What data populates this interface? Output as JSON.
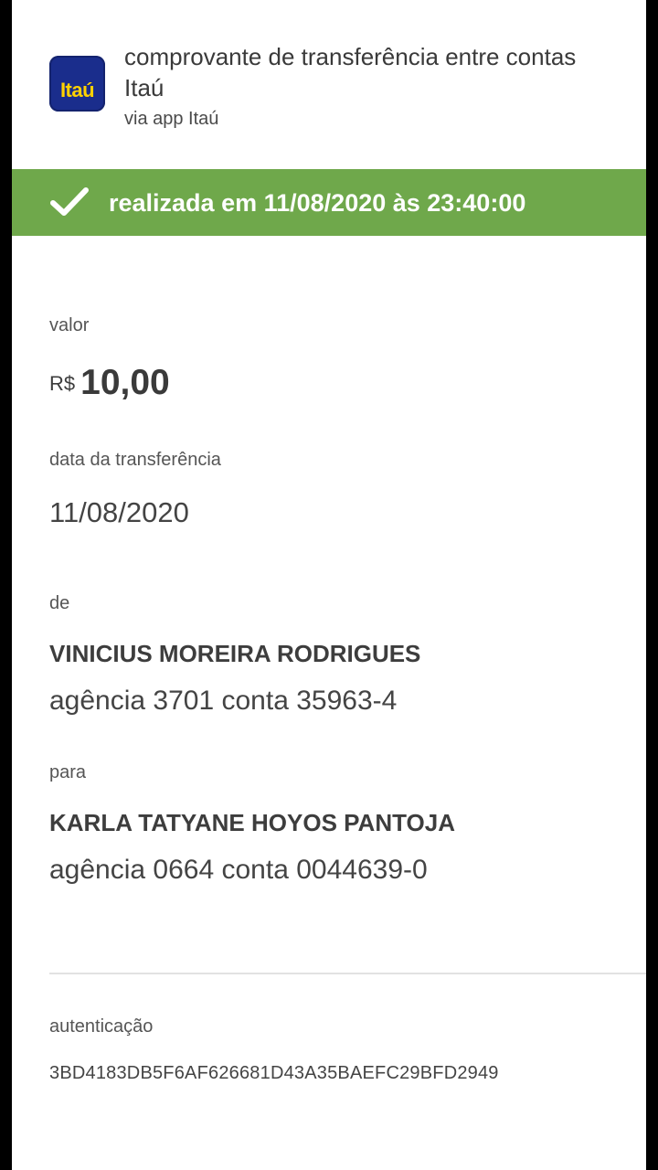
{
  "header": {
    "logo_text": "Itaú",
    "title": "comprovante de transferência entre contas Itaú",
    "subtitle": "via app Itaú"
  },
  "status": {
    "icon": "check-icon",
    "text": "realizada em 11/08/2020 às 23:40:00",
    "color": "#6fa84b"
  },
  "transfer": {
    "value_label": "valor",
    "currency": "R$",
    "amount": "10,00",
    "date_label": "data da transferência",
    "date": "11/08/2020"
  },
  "from": {
    "label": "de",
    "name": "VINICIUS MOREIRA RODRIGUES",
    "account": "agência 3701 conta 35963-4"
  },
  "to": {
    "label": "para",
    "name": "KARLA TATYANE HOYOS PANTOJA",
    "account": "agência 0664 conta 0044639-0"
  },
  "authentication": {
    "label": "autenticação",
    "code": "3BD4183DB5F6AF626681D43A35BAEFC29BFD2949"
  },
  "colors": {
    "brand_blue": "#1a2d8c",
    "brand_yellow": "#ffd200",
    "success_green": "#6fa84b"
  }
}
